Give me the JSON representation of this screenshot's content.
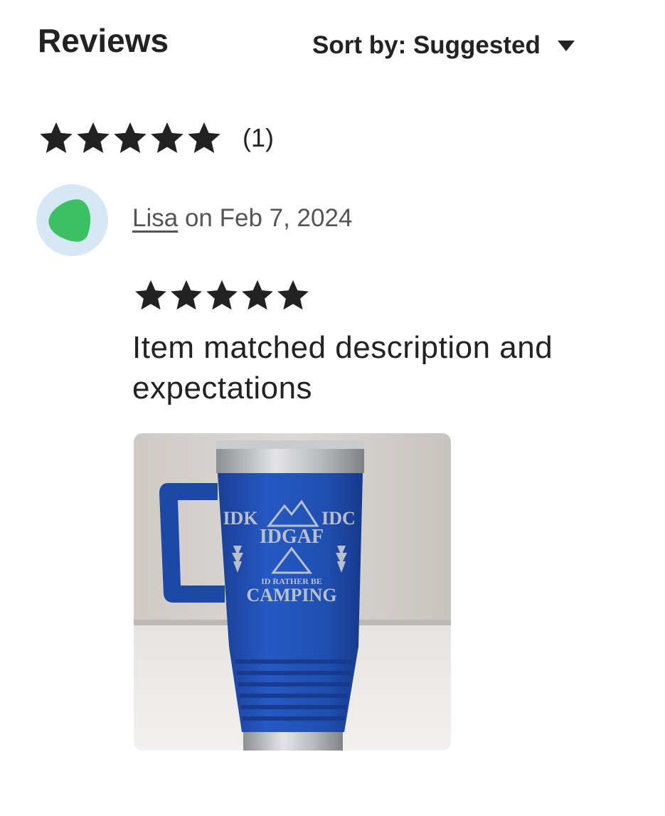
{
  "header": {
    "title": "Reviews",
    "sort_label": "Sort by: Suggested"
  },
  "summary": {
    "rating": 5,
    "rating_max": 5,
    "count_text": "(1)"
  },
  "review": {
    "reviewer_name": "Lisa",
    "date_text": "on Feb 7, 2024",
    "rating": 5,
    "rating_max": 5,
    "text": "Item matched description and expectations",
    "photo": {
      "engraving_lines": [
        "IDK",
        "IDC",
        "IDGAF",
        "ID RATHER BE",
        "CAMPING"
      ]
    }
  },
  "colors": {
    "star": "#222222",
    "avatar_bg": "#d6e8f5",
    "avatar_blob": "#3dbf63",
    "tumbler_blue": "#1f4fb0"
  },
  "icons": {
    "star": "star-icon",
    "caret": "caret-down-icon"
  }
}
